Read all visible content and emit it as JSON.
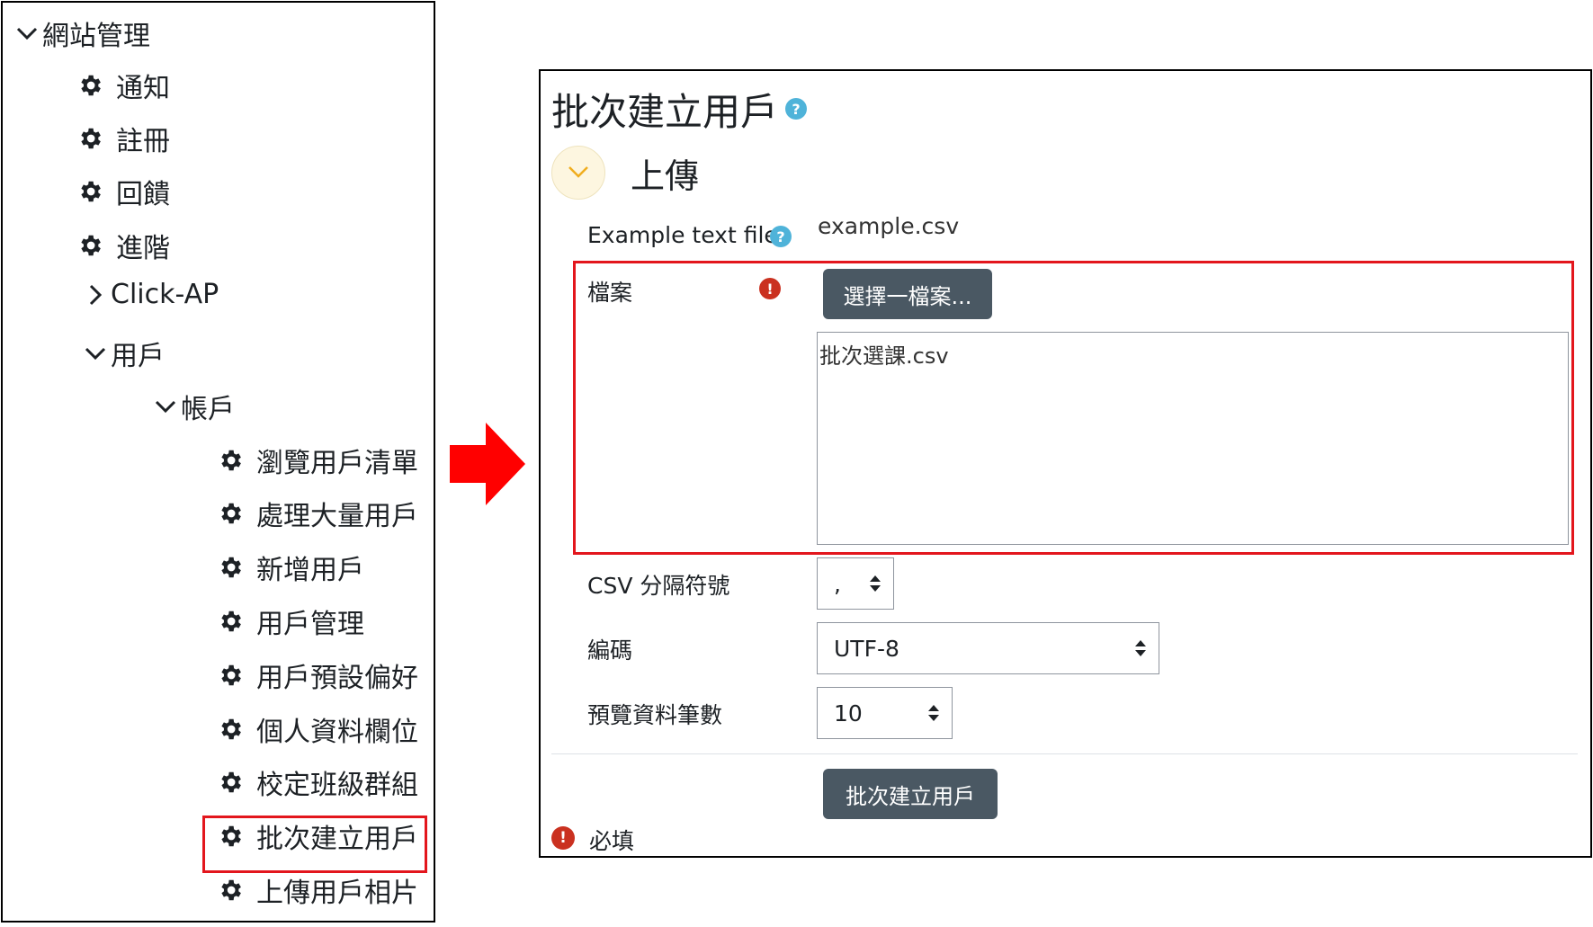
{
  "nav": {
    "root": "網站管理",
    "items": [
      "通知",
      "註冊",
      "回饋",
      "進階"
    ],
    "click_ap": "Click-AP",
    "users": "用戶",
    "accounts": "帳戶",
    "account_items": [
      "瀏覽用戶清單",
      "處理大量用戶",
      "新增用戶",
      "用戶管理",
      "用戶預設偏好",
      "個人資料欄位",
      "校定班級群組",
      "批次建立用戶",
      "上傳用戶相片"
    ],
    "active_item": "批次建立用戶"
  },
  "form": {
    "title": "批次建立用戶",
    "section": "上傳",
    "example_label": "Example text file",
    "example_file": "example.csv",
    "file_label": "檔案",
    "choose_button": "選擇一檔案...",
    "selected_file": "批次選課.csv",
    "csv_label": "CSV 分隔符號",
    "csv_value": ",",
    "encoding_label": "編碼",
    "encoding_value": "UTF-8",
    "preview_label": "預覽資料筆數",
    "preview_value": "10",
    "submit_button": "批次建立用戶",
    "required_note": "必填"
  },
  "colors": {
    "highlight": "#e3161d",
    "button": "#4a5863",
    "help_icon": "#4fb3d9",
    "required_icon": "#ca3120",
    "collapse_bg": "#fdf6e0",
    "collapse_chevron": "#f0ad1e"
  },
  "icons": {
    "nav_item": "gear-icon",
    "expand": "chevron-down-icon",
    "collapsed": "chevron-right-icon",
    "help": "question-circle-icon",
    "required": "exclamation-circle-icon"
  }
}
